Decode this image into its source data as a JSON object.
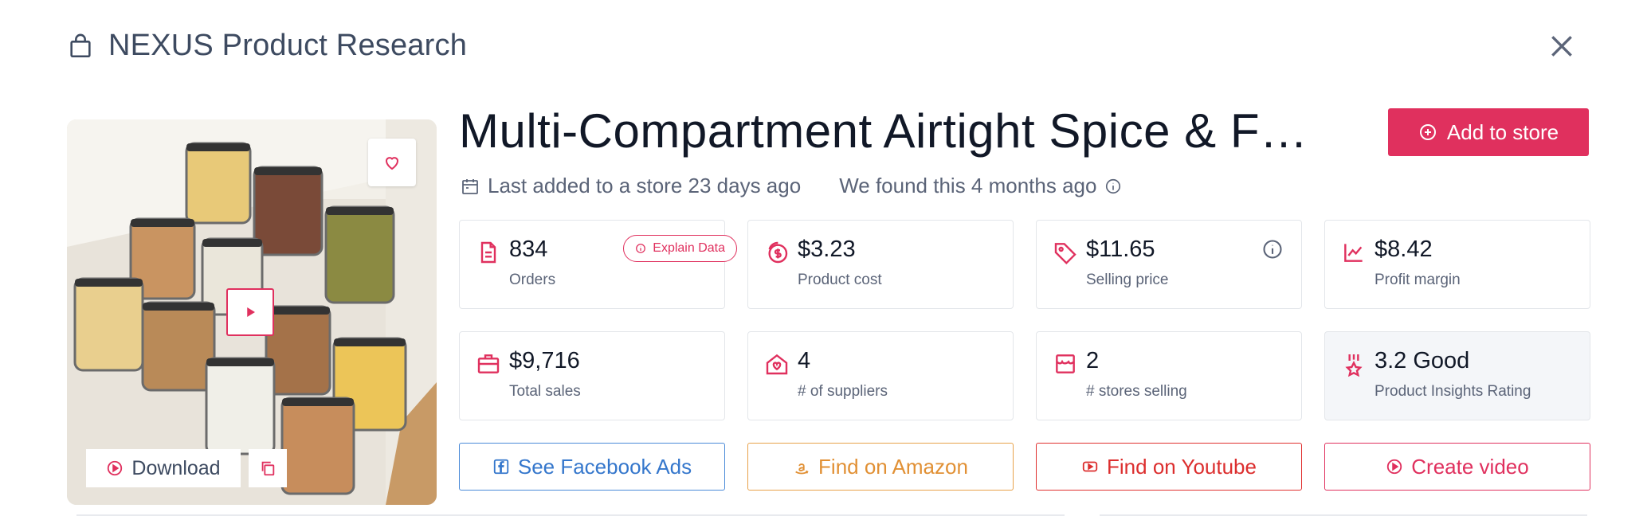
{
  "header": {
    "title": "NEXUS Product Research",
    "icon": "shopping-bag-icon"
  },
  "product": {
    "title": "Multi-Compartment Airtight Spice & F…",
    "last_added": "Last added to a store 23 days ago",
    "found": "We found this 4 months ago"
  },
  "buttons": {
    "add_to_store": "Add to store",
    "download": "Download",
    "explain_data": "Explain Data"
  },
  "stats": [
    {
      "value": "834",
      "label": "Orders",
      "icon": "document-icon"
    },
    {
      "value": "$3.23",
      "label": "Product cost",
      "icon": "coin-icon"
    },
    {
      "value": "$11.65",
      "label": "Selling price",
      "icon": "tag-icon"
    },
    {
      "value": "$8.42",
      "label": "Profit margin",
      "icon": "chart-icon"
    },
    {
      "value": "$9,716",
      "label": "Total sales",
      "icon": "briefcase-icon"
    },
    {
      "value": "4",
      "label": "# of suppliers",
      "icon": "supplier-house-icon"
    },
    {
      "value": "2",
      "label": "# stores selling",
      "icon": "store-icon"
    },
    {
      "value": "3.2 Good",
      "label": "Product Insights Rating",
      "icon": "award-icon"
    }
  ],
  "actions": {
    "facebook": "See Facebook Ads",
    "amazon": "Find on Amazon",
    "youtube": "Find on Youtube",
    "video": "Create video"
  },
  "colors": {
    "accent": "#e0305e",
    "facebook": "#3577cc",
    "amazon": "#e19034",
    "youtube": "#dc2e2e"
  }
}
